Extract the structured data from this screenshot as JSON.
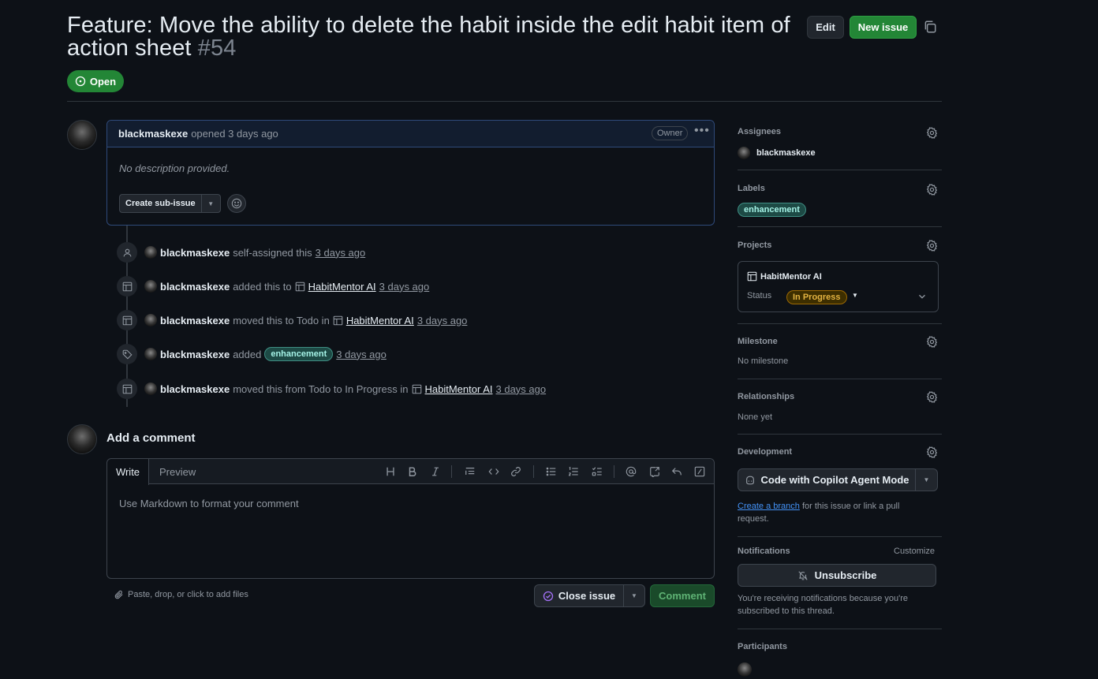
{
  "issue": {
    "title": "Feature: Move the ability to delete the habit inside the edit habit item of action sheet",
    "number": "#54",
    "state": "Open"
  },
  "header": {
    "edit_label": "Edit",
    "new_issue_label": "New issue"
  },
  "comment": {
    "author": "blackmaskexe",
    "meta": "opened 3 days ago",
    "owner_badge": "Owner",
    "body": "No description provided.",
    "create_subissue_label": "Create sub-issue"
  },
  "timeline": [
    {
      "actor": "blackmaskexe",
      "text": "self-assigned this",
      "time": "3 days ago",
      "icon": "person-icon"
    },
    {
      "actor": "blackmaskexe",
      "text": "added this to",
      "project": "HabitMentor AI",
      "time": "3 days ago",
      "icon": "table-icon"
    },
    {
      "actor": "blackmaskexe",
      "text": "moved this to Todo in",
      "project": "HabitMentor AI",
      "time": "3 days ago",
      "icon": "table-icon"
    },
    {
      "actor": "blackmaskexe",
      "text": "added",
      "label": "enhancement",
      "time": "3 days ago",
      "icon": "tag-icon"
    },
    {
      "actor": "blackmaskexe",
      "text": "moved this from Todo to In Progress in",
      "project": "HabitMentor AI",
      "time": "3 days ago",
      "icon": "table-icon"
    }
  ],
  "new_comment": {
    "heading": "Add a comment",
    "tab_write": "Write",
    "tab_preview": "Preview",
    "placeholder": "Use Markdown to format your comment",
    "attach_label": "Paste, drop, or click to add files",
    "close_issue_label": "Close issue",
    "comment_label": "Comment"
  },
  "sidebar": {
    "assignees": {
      "heading": "Assignees",
      "user": "blackmaskexe"
    },
    "labels": {
      "heading": "Labels",
      "label": "enhancement"
    },
    "projects": {
      "heading": "Projects",
      "name": "HabitMentor AI",
      "status_label": "Status",
      "status_value": "In Progress"
    },
    "milestone": {
      "heading": "Milestone",
      "value": "No milestone"
    },
    "relationships": {
      "heading": "Relationships",
      "value": "None yet"
    },
    "development": {
      "heading": "Development",
      "copilot_label": "Code with Copilot Agent Mode",
      "link_text": "Create a branch",
      "rest_text": " for this issue or link a pull request."
    },
    "notifications": {
      "heading": "Notifications",
      "customize": "Customize",
      "unsubscribe": "Unsubscribe",
      "note": "You're receiving notifications because you're subscribed to this thread."
    },
    "participants": {
      "heading": "Participants"
    }
  },
  "colors": {
    "background": "#0d1117",
    "open_green": "#238636",
    "label_teal": "#1d4a45",
    "status_yellow": "#e3b341",
    "link_blue": "#4493f8"
  }
}
